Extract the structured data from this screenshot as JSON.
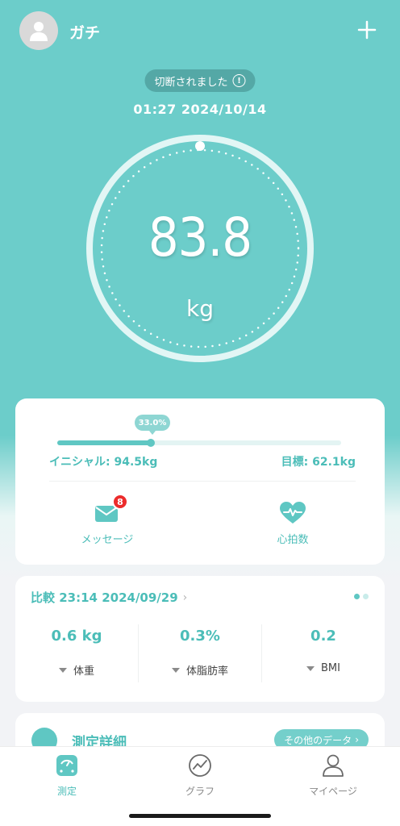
{
  "header": {
    "username": "ガチ"
  },
  "status": {
    "connection_text": "切断されました",
    "timestamp": "01:27 2024/10/14"
  },
  "measurement": {
    "weight": "83.8",
    "unit": "kg"
  },
  "goal_progress": {
    "percent_label": "33.0%",
    "progress": 0.33,
    "initial_label": "イニシャル: 94.5kg",
    "goal_label": "目標: 62.1kg"
  },
  "features": {
    "messages_label": "メッセージ",
    "messages_badge": "8",
    "heart_rate_label": "心拍数"
  },
  "comparison": {
    "title": "比較 23:14 2024/09/29",
    "stats": [
      {
        "value": "0.6 kg",
        "name": "体重"
      },
      {
        "value": "0.3%",
        "name": "体脂肪率"
      },
      {
        "value": "0.2",
        "name": "BMI"
      }
    ]
  },
  "details": {
    "title": "測定詳細",
    "more_label": "その他のデータ"
  },
  "tabs": [
    {
      "label": "測定"
    },
    {
      "label": "グラフ"
    },
    {
      "label": "マイページ"
    }
  ],
  "colors": {
    "accent": "#5fc7c3",
    "background": "#6ccdca",
    "badge": "#ec2c2c"
  }
}
